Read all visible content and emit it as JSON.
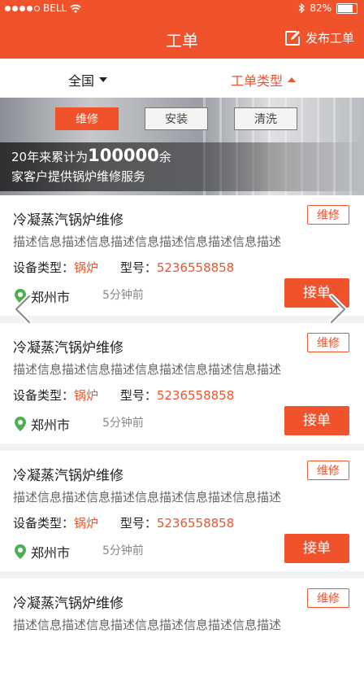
{
  "status_bar": {
    "carrier": "BELL",
    "battery": "82%"
  },
  "nav": {
    "title": "工单",
    "publish_label": "发布工单"
  },
  "filters": {
    "region": "全国",
    "type": "工单类型"
  },
  "banner": {
    "tabs": [
      "维修",
      "安装",
      "清洗"
    ],
    "line1_prefix": "20年来累计为",
    "line1_number": "100000",
    "line1_suffix": "余",
    "line2": "家客户提供锅炉维修服务"
  },
  "orders": [
    {
      "title": "冷凝蒸汽锅炉维修",
      "tag": "维修",
      "description": "描述信息描述信息描述信息描述信息描述信息描述",
      "device_label": "设备类型：",
      "device": "锅炉",
      "model_label": "型号：",
      "model": "5236558858",
      "city": "郑州市",
      "time": "5分钟前",
      "action": "接单"
    },
    {
      "title": "冷凝蒸汽锅炉维修",
      "tag": "维修",
      "description": "描述信息描述信息描述信息描述信息描述信息描述",
      "device_label": "设备类型：",
      "device": "锅炉",
      "model_label": "型号：",
      "model": "5236558858",
      "city": "郑州市",
      "time": "5分钟前",
      "action": "接单"
    },
    {
      "title": "冷凝蒸汽锅炉维修",
      "tag": "维修",
      "description": "描述信息描述信息描述信息描述信息描述信息描述",
      "device_label": "设备类型：",
      "device": "锅炉",
      "model_label": "型号：",
      "model": "5236558858",
      "city": "郑州市",
      "time": "5分钟前",
      "action": "接单"
    },
    {
      "title": "冷凝蒸汽锅炉维修",
      "tag": "维修",
      "description": "描述信息描述信息描述信息描述信息描述信息描述",
      "device_label": "",
      "device": "",
      "model_label": "",
      "model": "",
      "city": "",
      "time": "",
      "action": ""
    }
  ],
  "icons": {
    "wifi": "wifi-icon",
    "bluetooth": "bluetooth-icon",
    "edit": "edit-icon",
    "location": "location-pin-icon",
    "arrows": [
      "chevron-left-icon",
      "chevron-right-icon"
    ]
  },
  "colors": {
    "accent": "#f0532b",
    "background": "#f2f2f2"
  }
}
